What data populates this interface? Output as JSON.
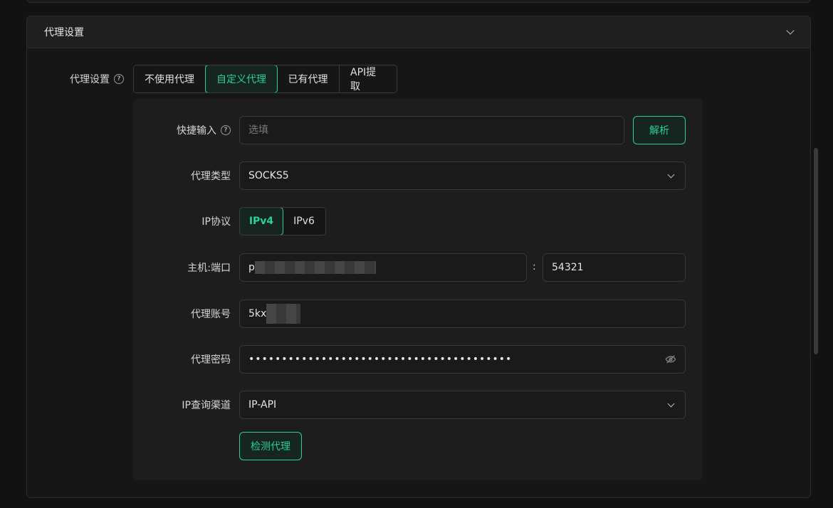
{
  "section": {
    "title": "代理设置"
  },
  "proxy_setting": {
    "label": "代理设置",
    "options": [
      "不使用代理",
      "自定义代理",
      "已有代理",
      "API提取"
    ],
    "selected": "自定义代理"
  },
  "quick_input": {
    "label": "快捷输入",
    "placeholder": "选填",
    "parse_button": "解析"
  },
  "proxy_type": {
    "label": "代理类型",
    "value": "SOCKS5"
  },
  "ip_protocol": {
    "label": "IP协议",
    "options": [
      "IPv4",
      "IPv6"
    ],
    "selected": "IPv4"
  },
  "host_port": {
    "label": "主机:端口",
    "host_visible": "p",
    "separator": ":",
    "port": "54321"
  },
  "account": {
    "label": "代理账号",
    "value_visible": "5kx"
  },
  "password": {
    "label": "代理密码",
    "masked": "••••••••••••••••••••••••••••••••••••••••"
  },
  "ip_query": {
    "label": "IP查询渠道",
    "value": "IP-API"
  },
  "check_button": "检测代理",
  "colors": {
    "accent": "#2ecf95",
    "background": "#121212",
    "panel": "#1d1d1d"
  }
}
